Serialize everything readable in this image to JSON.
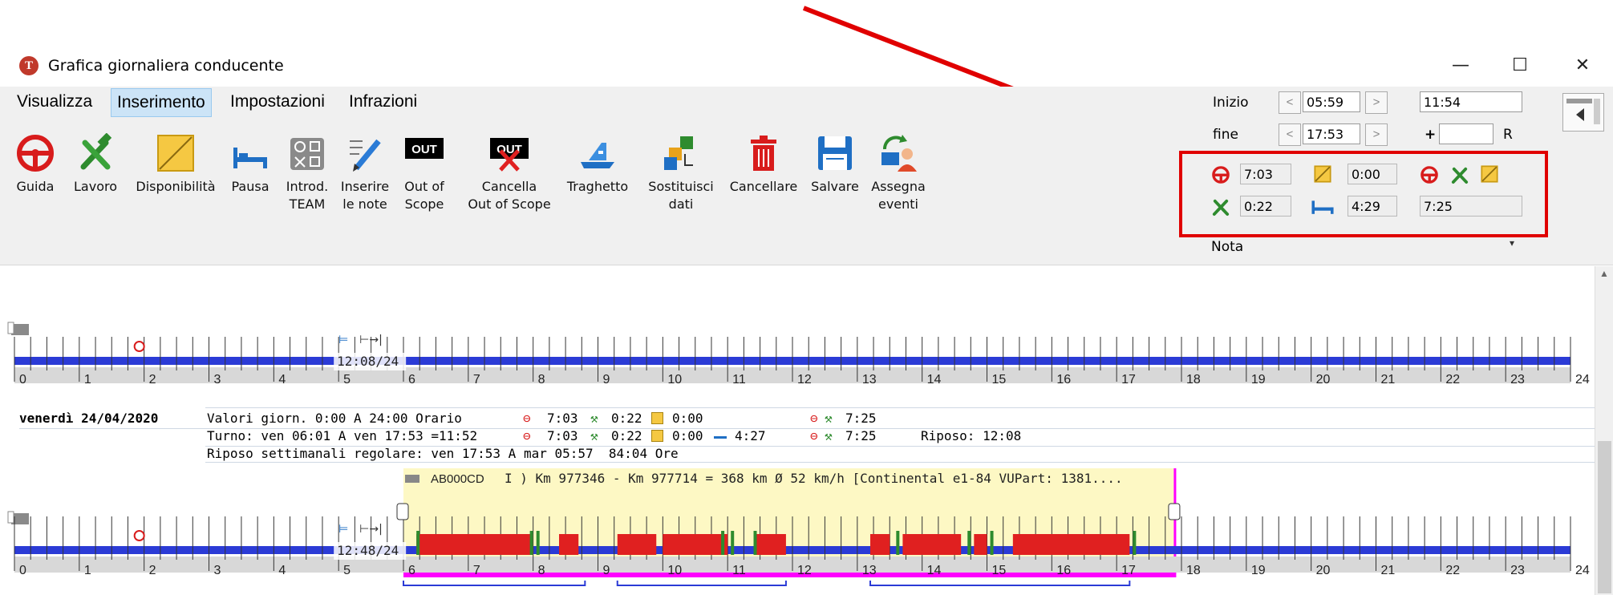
{
  "window": {
    "title": "Grafica giornaliera conducente",
    "controls": {
      "minimize": "—",
      "maximize": "☐",
      "close": "✕"
    }
  },
  "menu": [
    {
      "label": "Visualizza"
    },
    {
      "label": "Inserimento"
    },
    {
      "label": "Impostazioni"
    },
    {
      "label": "Infrazioni"
    }
  ],
  "toolbar": [
    {
      "label": "Guida",
      "icon": "steering-wheel-icon"
    },
    {
      "label": "Lavoro",
      "icon": "hammer-wrench-icon"
    },
    {
      "label": "Disponibilità",
      "icon": "availability-icon"
    },
    {
      "label": "Pausa",
      "icon": "bed-icon"
    },
    {
      "label": "Introd.\nTEAM",
      "icon": "team-icon"
    },
    {
      "label": "Inserire\nle note",
      "icon": "pencil-note-icon"
    },
    {
      "label": "Out of\nScope",
      "icon": "out-of-scope-icon",
      "badge": "OUT"
    },
    {
      "label": "Cancella\nOut of Scope",
      "icon": "cancel-out-of-scope-icon",
      "badge": "OUT"
    },
    {
      "label": "Traghetto",
      "icon": "ferry-icon"
    },
    {
      "label": "Sostituisci\ndati",
      "icon": "replace-data-icon"
    },
    {
      "label": "Cancellare",
      "icon": "trash-icon"
    },
    {
      "label": "Salvare",
      "icon": "save-icon"
    },
    {
      "label": "Assegna\neventi",
      "icon": "assign-events-icon"
    }
  ],
  "panel": {
    "inizio_label": "Inizio",
    "fine_label": "fine",
    "inizio_time": "05:59",
    "fine_time": "17:53",
    "right_time": "11:54",
    "plus_label": "+",
    "plus_value": "",
    "r_label": "R",
    "prev": "<",
    "next": ">",
    "guida_total": "7:03",
    "disponibilita_total": "0:00",
    "lavoro_total": "0:22",
    "pausa_total": "4:29",
    "guida_lavoro_total": "7:25",
    "nota_label": "Nota",
    "nota_value": ""
  },
  "colors": {
    "highlight": "#e00000",
    "drive": "#e02020",
    "work": "#2e8b2e",
    "available": "#f2c12e",
    "rest_bar": "#2b3bd6",
    "vehicle_bg": "#fdf8c4",
    "out_of_scope": "#ff00ff",
    "ribbon": "#f0f0f0"
  },
  "timeline1": {
    "hours": [
      "0",
      "1",
      "2",
      "3",
      "4",
      "5",
      "6",
      "7",
      "8",
      "9",
      "10",
      "11",
      "12",
      "13",
      "14",
      "15",
      "16",
      "17",
      "18",
      "19",
      "20",
      "21",
      "22",
      "23",
      "24"
    ],
    "rest_label": "12:08/24"
  },
  "day_info": {
    "date": "venerdì 24/04/2020",
    "line1_left": "Valori giorn. 0:00 A 24:00 Orario",
    "line1_drive": "7:03",
    "line1_work": "0:22",
    "line1_avail": "0:00",
    "line1_total": "7:25",
    "line2_left": "Turno: ven 06:01 A ven 17:53 =11:52",
    "line2_drive": "7:03",
    "line2_work": "0:22",
    "line2_avail": "0:00",
    "line2_pause": "4:27",
    "line2_total": "7:25",
    "line2_rest": "Riposo: 12:08",
    "line3": "Riposo settimanali regolare: ven 17:53 A mar 05:57  84:04 Ore"
  },
  "timeline2": {
    "hours": [
      "0",
      "1",
      "2",
      "3",
      "4",
      "5",
      "6",
      "7",
      "8",
      "9",
      "10",
      "11",
      "12",
      "13",
      "14",
      "15",
      "16",
      "17",
      "18",
      "19",
      "20",
      "21",
      "22",
      "23",
      "24"
    ],
    "rest_label": "12:48/24",
    "vehicle_plate": "AB000CD",
    "vehicle_info": "I ) Km 977346 - Km 977714 = 368 km    Ø 52 km/h [Continental e1-84 VUPart: 1381....",
    "vehicle_start": 6.0,
    "vehicle_end": 17.9,
    "drive_segments": [
      [
        6.2,
        8.0
      ],
      [
        8.4,
        8.7
      ],
      [
        9.3,
        9.9
      ],
      [
        10.0,
        11.0
      ],
      [
        11.4,
        11.9
      ],
      [
        13.2,
        13.5
      ],
      [
        13.7,
        14.6
      ],
      [
        14.8,
        15.0
      ],
      [
        15.4,
        17.2
      ]
    ],
    "work_marks": [
      6.2,
      7.95,
      8.05,
      10.9,
      11.05,
      11.4,
      13.6,
      14.7,
      15.05,
      17.25
    ],
    "brackets": [
      [
        6.0,
        8.8
      ],
      [
        9.3,
        11.9
      ],
      [
        13.2,
        17.2
      ]
    ]
  }
}
